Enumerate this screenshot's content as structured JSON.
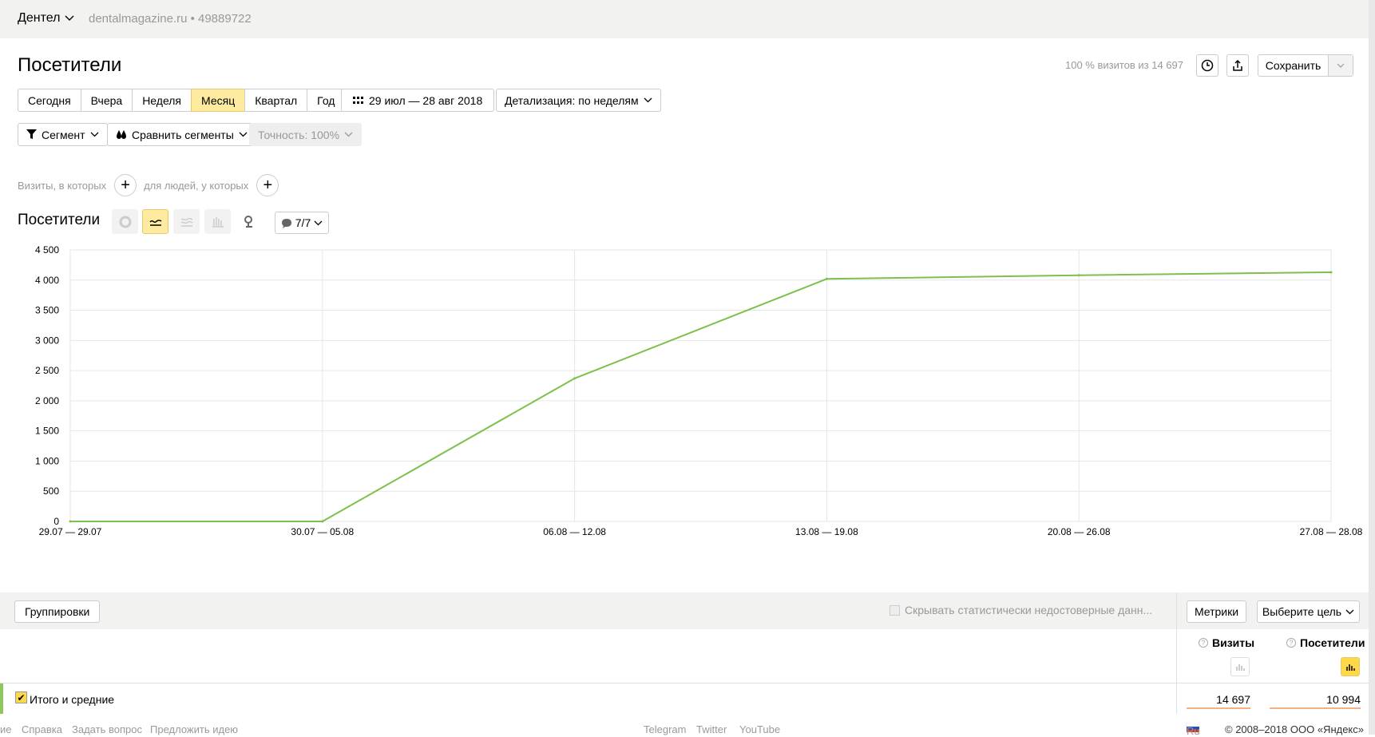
{
  "topbar": {
    "site_name": "Дентел",
    "domain": "dentalmagazine.ru • 49889722"
  },
  "page": {
    "title": "Посетители",
    "share_info": "100 % визитов из 14 697",
    "save_label": "Сохранить"
  },
  "periods": [
    "Сегодня",
    "Вчера",
    "Неделя",
    "Месяц",
    "Квартал",
    "Год"
  ],
  "active_period": "Месяц",
  "date_range": "29 июл — 28 авг 2018",
  "detail": "Детализация: по неделям",
  "segment": "Сегмент",
  "compare": "Сравнить сегменты",
  "accuracy": "Точность: 100%",
  "filters": {
    "visits_label": "Визиты, в которых",
    "people_label": "для людей, у которых"
  },
  "chart_header": {
    "title": "Посетители",
    "notes_label": "7/7"
  },
  "chart_data": {
    "type": "line",
    "categories": [
      "29.07 — 29.07",
      "30.07 — 05.08",
      "06.08 — 12.08",
      "13.08 — 19.08",
      "20.08 — 26.08",
      "27.08 — 28.08"
    ],
    "series": [
      {
        "values": [
          0,
          0,
          2370,
          4020,
          4080,
          4130
        ],
        "color": "#7dc04c"
      }
    ],
    "ylim": [
      0,
      4500
    ],
    "yticks": [
      "0",
      "500",
      "1 000",
      "1 500",
      "2 000",
      "2 500",
      "3 000",
      "3 500",
      "4 000",
      "4 500"
    ],
    "ytick_values": [
      0,
      500,
      1000,
      1500,
      2000,
      2500,
      3000,
      3500,
      4000,
      4500
    ],
    "grid": true
  },
  "table": {
    "grouping_label": "Группировки",
    "hide_label": "Скрывать статистически недостоверные данн...",
    "metrics_label": "Метрики",
    "goal_label": "Выберите цель",
    "columns": [
      "Визиты",
      "Посетители"
    ],
    "total_label": "Итого и средние",
    "totals": [
      "14 697",
      "10 994"
    ]
  },
  "footer": {
    "left_cut": "ие",
    "links": [
      "Справка",
      "Задать вопрос",
      "Предложить идею"
    ],
    "social": [
      "Telegram",
      "Twitter",
      "YouTube"
    ],
    "lang": "Ru",
    "copyright": "© 2008–2018 ООО «Яндекс»"
  }
}
